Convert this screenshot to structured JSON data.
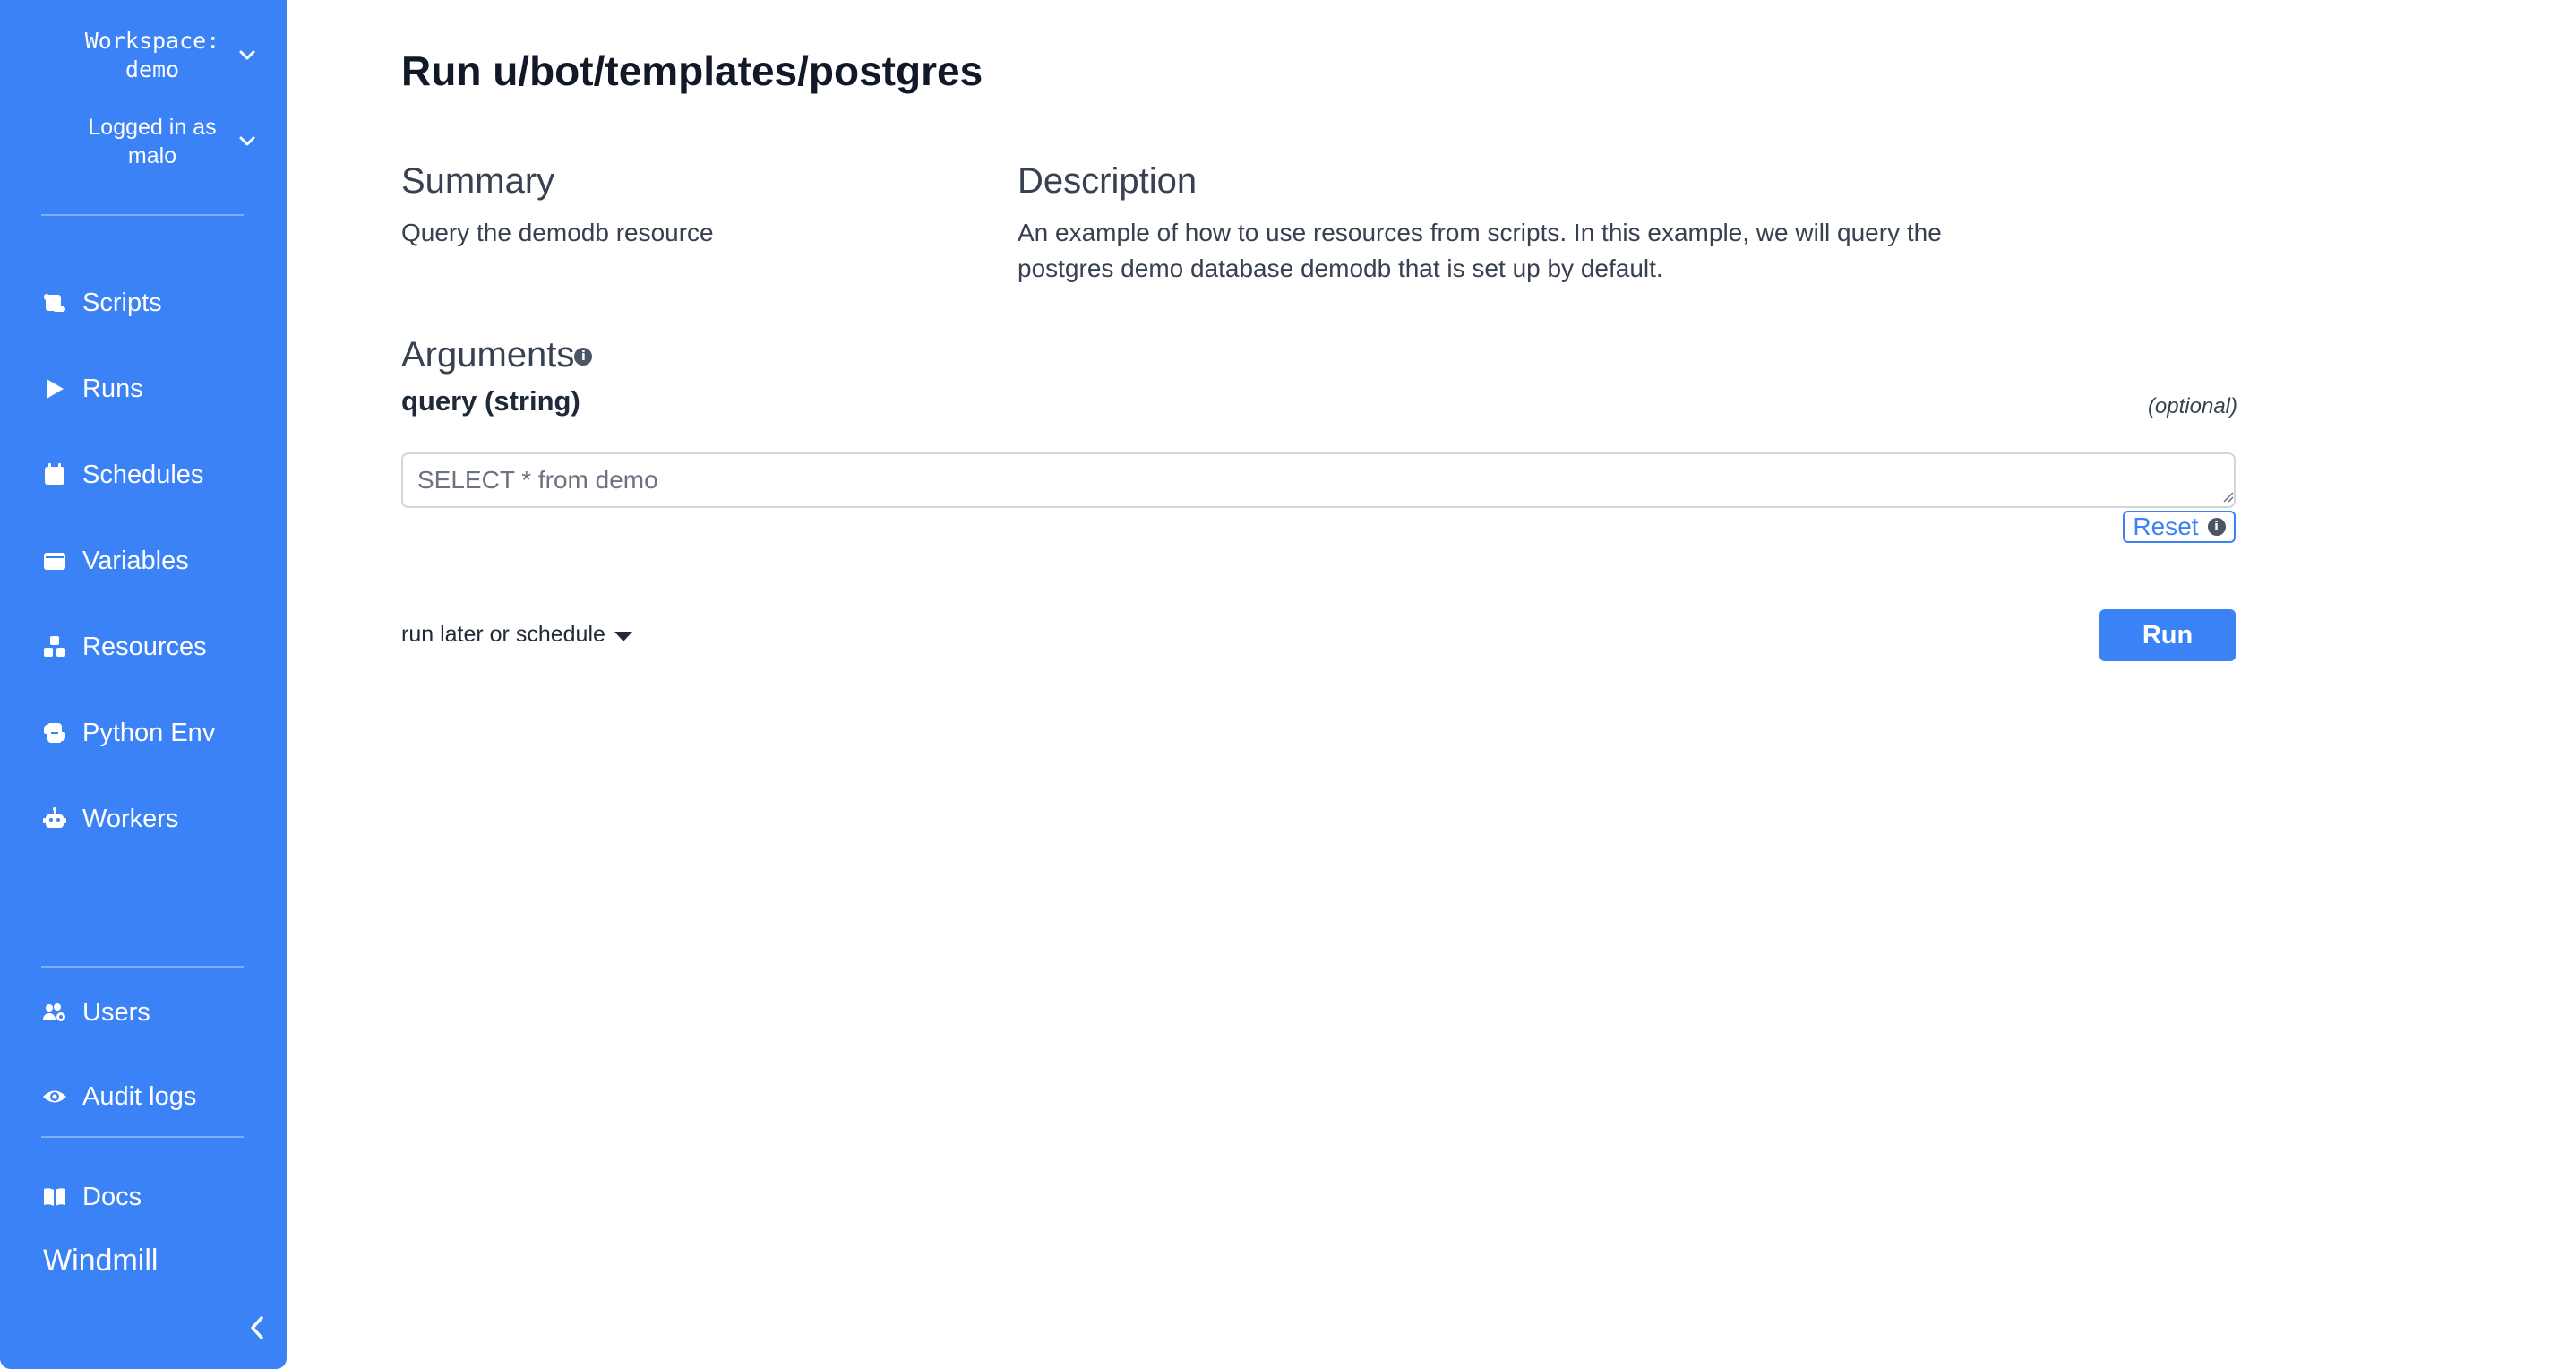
{
  "sidebar": {
    "workspace_label": "Workspace: demo",
    "user_label": "Logged in as malo",
    "nav_items": [
      {
        "label": "Scripts",
        "icon": "scroll-icon"
      },
      {
        "label": "Runs",
        "icon": "play-icon"
      },
      {
        "label": "Schedules",
        "icon": "calendar-icon"
      },
      {
        "label": "Variables",
        "icon": "wallet-icon"
      },
      {
        "label": "Resources",
        "icon": "cubes-icon"
      },
      {
        "label": "Python Env",
        "icon": "python-icon"
      },
      {
        "label": "Workers",
        "icon": "robot-icon"
      }
    ],
    "bottom_items": [
      {
        "label": "Users",
        "icon": "users-cog-icon"
      },
      {
        "label": "Audit logs",
        "icon": "eye-icon"
      },
      {
        "label": "Docs",
        "icon": "book-icon"
      }
    ],
    "brand": "Windmill",
    "accent_color": "#3b82f6"
  },
  "main": {
    "title": "Run u/bot/templates/postgres",
    "summary_heading": "Summary",
    "summary_text": "Query the demodb resource",
    "description_heading": "Description",
    "description_text": "An example of how to use resources from scripts. In this example, we will query the postgres demo database demodb that is set up by default.",
    "arguments_heading": "Arguments",
    "argument": {
      "name": "query (string)",
      "optional_label": "(optional)",
      "placeholder": "SELECT * from demo",
      "value": ""
    },
    "reset_label": "Reset",
    "schedule_label": "run later or schedule",
    "run_label": "Run"
  }
}
